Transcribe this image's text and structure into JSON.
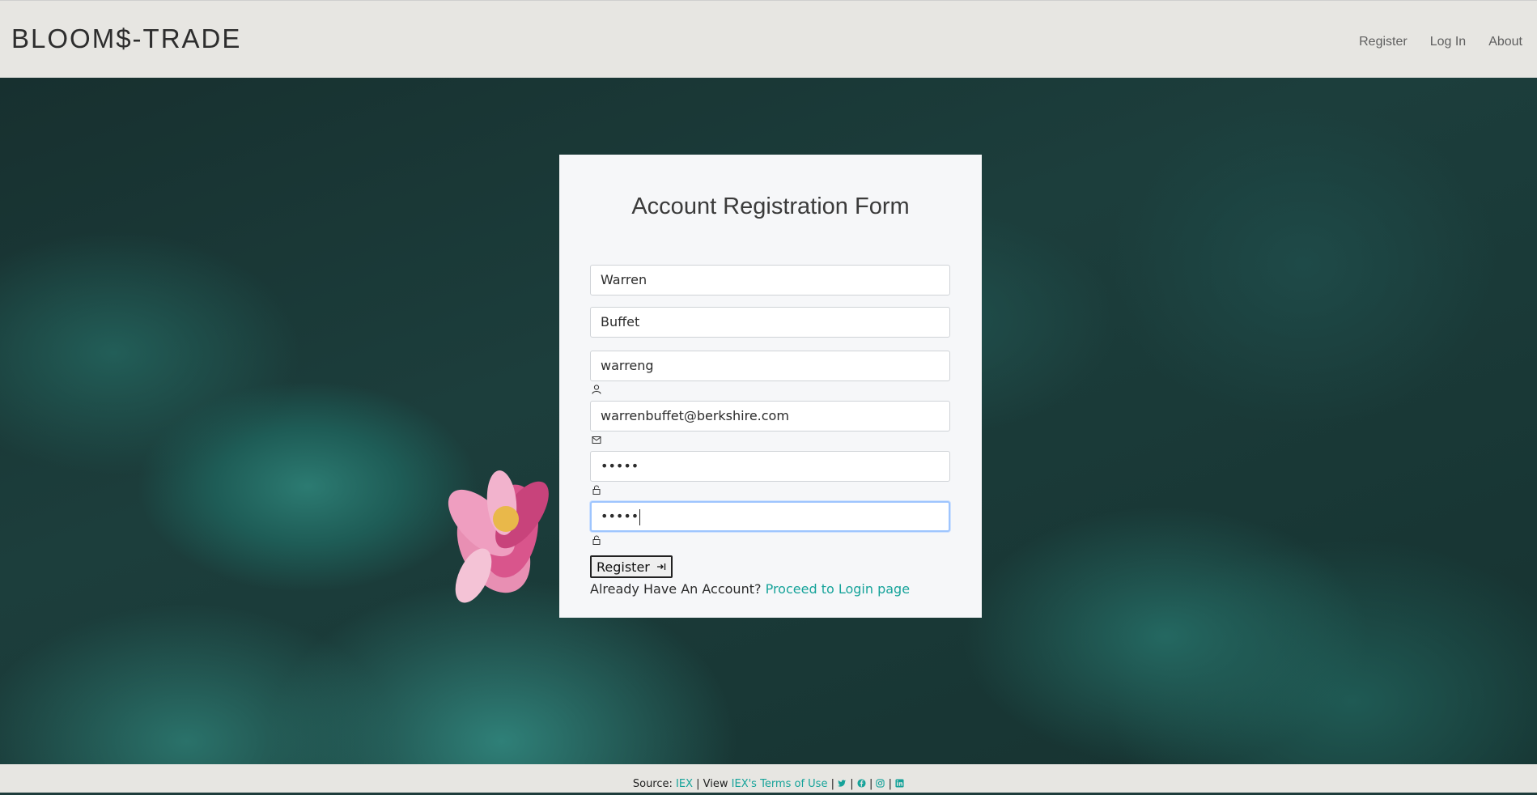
{
  "navbar": {
    "brand": "BLOOM$-TRADE",
    "links": [
      "Register",
      "Log In",
      "About"
    ]
  },
  "form": {
    "title": "Account Registration Form",
    "first_name": "Warren",
    "last_name": "Buffet",
    "username": "warreng",
    "email": "warrenbuffet@berkshire.com",
    "password_masked": "•••••",
    "confirm_password_masked": "•••••",
    "register_label": "Register",
    "already_text": "Already Have An Account?",
    "login_link": "Proceed to Login page"
  },
  "footer": {
    "source_label": "Source:",
    "source_link": "IEX",
    "view_label": "| View",
    "terms_link": "IEX's Terms of Use",
    "separator": "|",
    "social_icons": [
      "twitter-icon",
      "facebook-icon",
      "instagram-icon",
      "linkedin-icon"
    ]
  },
  "colors": {
    "accent": "#16a39a",
    "navbar_bg": "#e7e6e2",
    "card_bg": "#f6f7f9",
    "focus_ring": "#9ec5fe"
  }
}
